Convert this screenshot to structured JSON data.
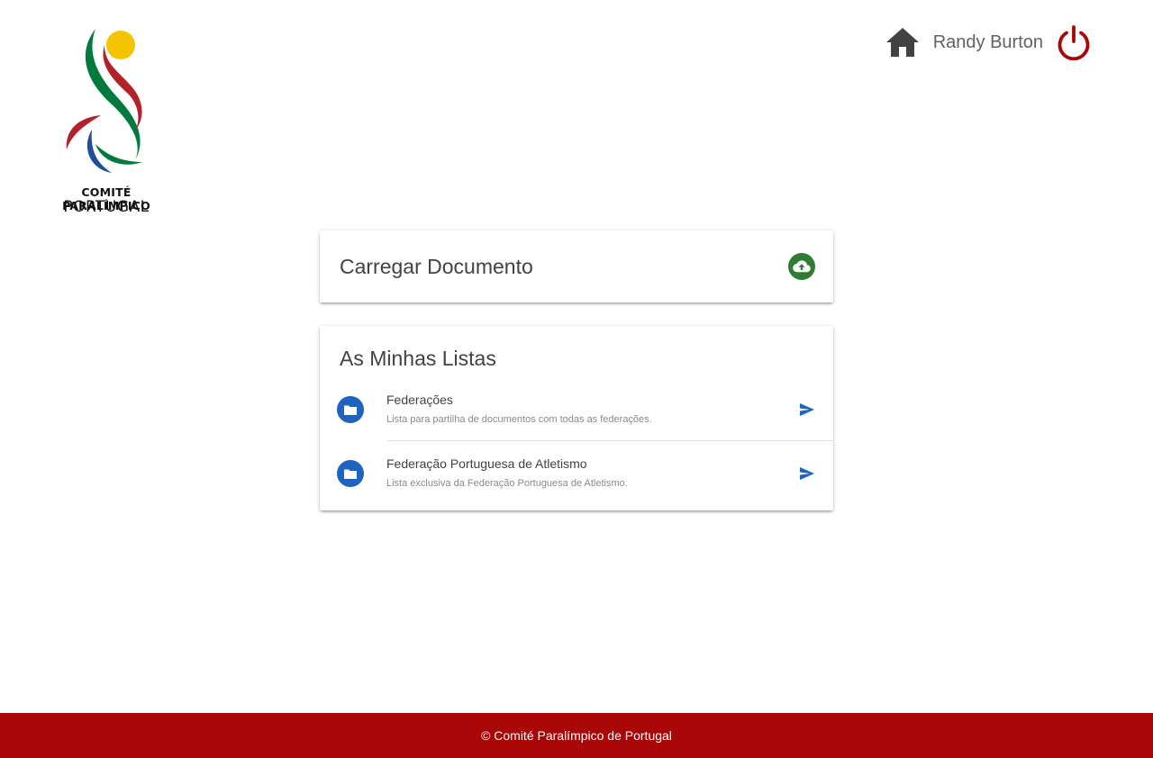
{
  "logo": {
    "line1": "COMITÉ PARALÍMPICO",
    "line2": "PORTUGAL",
    "colors": {
      "yellow": "#f5c400",
      "red": "#b2222b",
      "green": "#007a3d",
      "blue": "#1f4e9c"
    }
  },
  "header": {
    "home_icon": "home-icon",
    "user_name": "Randy Burton",
    "logout_icon": "power-icon",
    "logout_color": "#a80607"
  },
  "upload_card": {
    "title": "Carregar Documento",
    "icon": "cloud-upload-icon",
    "icon_color": "#2e7d32"
  },
  "lists_card": {
    "title": "As Minhas Listas",
    "items": [
      {
        "title": "Federações",
        "subtitle": "Lista para partilha de documentos com todas as federações.",
        "icon": "folder-icon",
        "action_icon": "send-icon"
      },
      {
        "title": "Federação Portuguesa de Atletismo",
        "subtitle": "Lista exclusiva da Federação Portuguesa de Atletismo.",
        "icon": "folder-icon",
        "action_icon": "send-icon"
      }
    ],
    "accent_color": "#1e62c2"
  },
  "footer": {
    "text": "© Comité Paralímpico de Portugal",
    "background": "#a80607"
  }
}
